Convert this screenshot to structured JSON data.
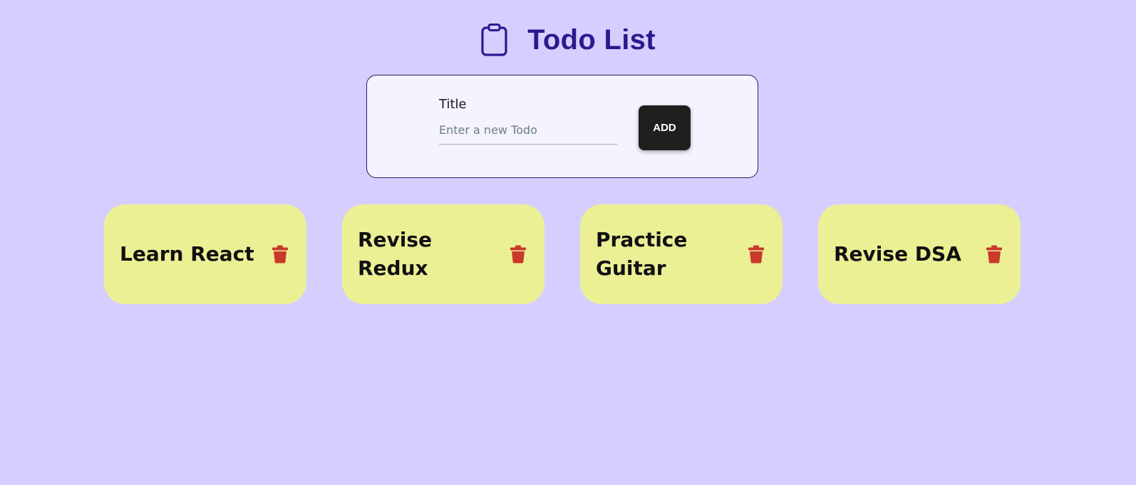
{
  "header": {
    "title": "Todo List",
    "icon": "clipboard-icon",
    "title_color": "#2a1a8e"
  },
  "form": {
    "title_label": "Title",
    "input_value": "",
    "input_placeholder": "Enter a new Todo",
    "add_label": "ADD"
  },
  "todos": [
    {
      "title": "Learn React",
      "icon": "trash-icon"
    },
    {
      "title": "Revise Redux",
      "icon": "trash-icon"
    },
    {
      "title": "Practice Guitar",
      "icon": "trash-icon"
    },
    {
      "title": "Revise DSA",
      "icon": "trash-icon"
    }
  ],
  "colors": {
    "background": "#d6ceff",
    "card": "#ecf095",
    "trash": "#c9392c",
    "button": "#1f1f1f"
  }
}
